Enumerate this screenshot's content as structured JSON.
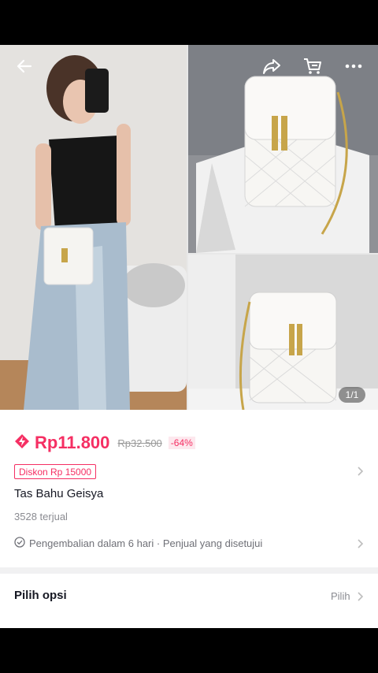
{
  "header": {
    "icons": [
      "back-arrow-icon",
      "share-icon",
      "cart-icon",
      "more-icon"
    ]
  },
  "gallery": {
    "counter": "1/1"
  },
  "product": {
    "price": "Rp11.800",
    "old_price": "Rp32.500",
    "discount_pct": "-64%",
    "voucher": "Diskon Rp 15000",
    "title": "Tas Bahu Geisya",
    "sold": "3528 terjual",
    "return_policy": "Pengembalian dalam 6 hari · Penjual yang disetujui"
  },
  "options": {
    "label": "Pilih opsi",
    "action": "Pilih"
  },
  "colors": {
    "accent": "#f52f63",
    "text": "#161823",
    "muted": "#8a8b91"
  }
}
